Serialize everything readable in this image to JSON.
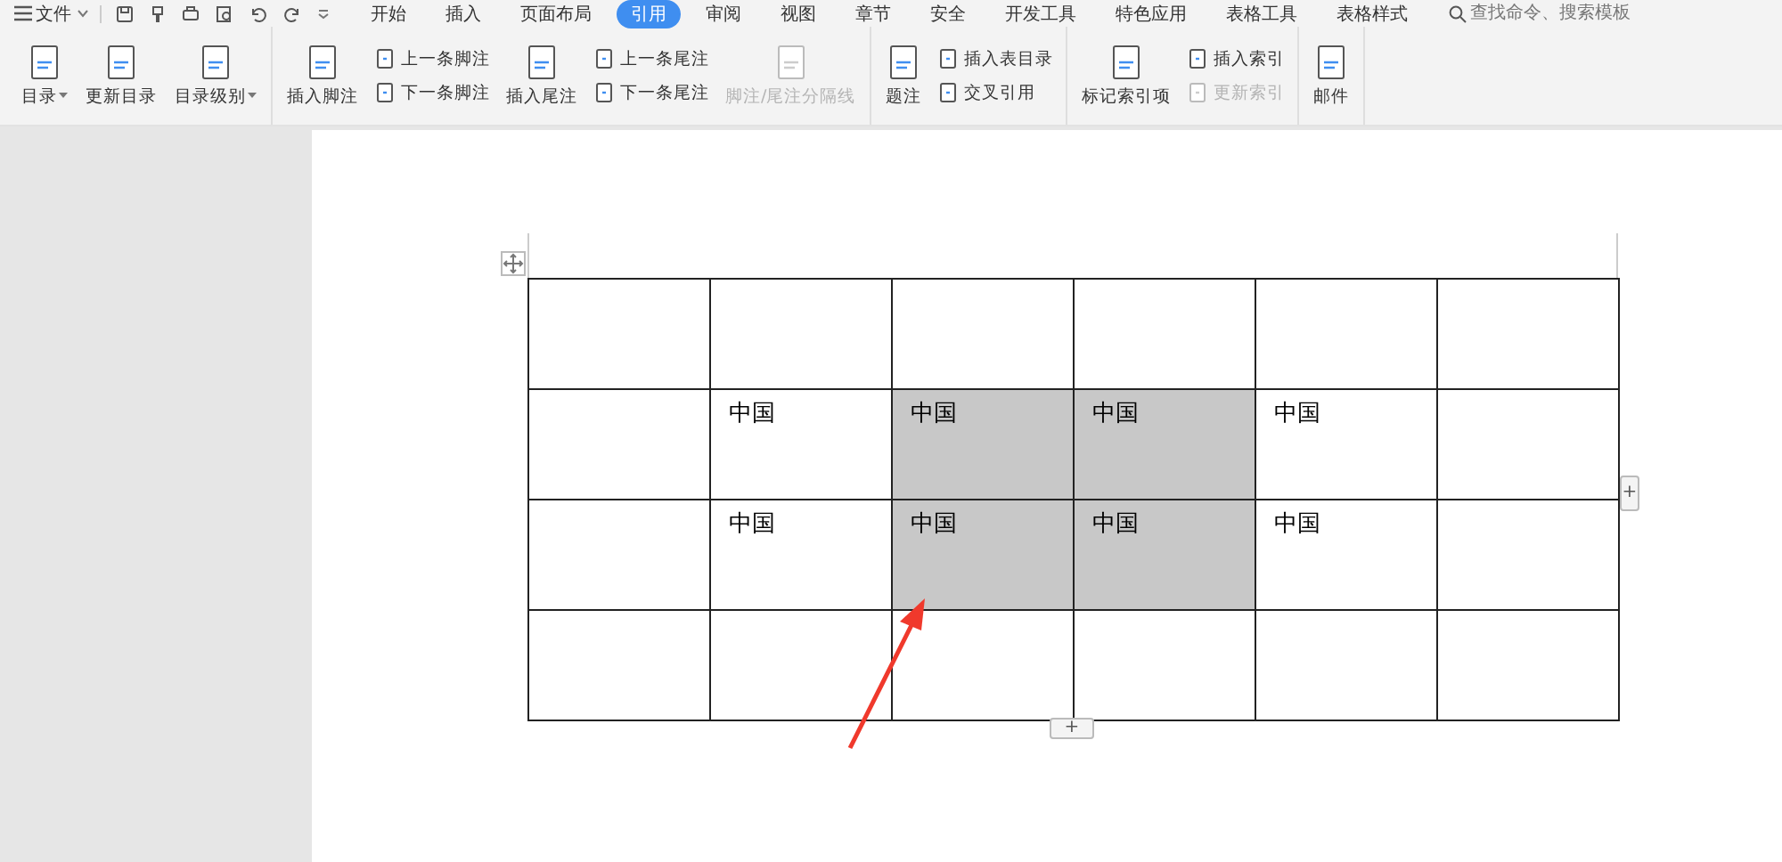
{
  "menubar": {
    "file_menu": "文件",
    "tabs": [
      {
        "label": "开始",
        "selected": false
      },
      {
        "label": "插入",
        "selected": false
      },
      {
        "label": "页面布局",
        "selected": false
      },
      {
        "label": "引用",
        "selected": true
      },
      {
        "label": "审阅",
        "selected": false
      },
      {
        "label": "视图",
        "selected": false
      },
      {
        "label": "章节",
        "selected": false
      },
      {
        "label": "安全",
        "selected": false
      },
      {
        "label": "开发工具",
        "selected": false
      },
      {
        "label": "特色应用",
        "selected": false
      },
      {
        "label": "表格工具",
        "selected": false
      },
      {
        "label": "表格样式",
        "selected": false
      }
    ],
    "search": {
      "placeholder": "查找命令、搜索模板"
    }
  },
  "ribbon": {
    "groups": [
      {
        "items": [
          {
            "kind": "large",
            "label": "目录",
            "dropdown": true,
            "disabled": false
          },
          {
            "kind": "large",
            "label": "更新目录",
            "dropdown": false,
            "disabled": false
          },
          {
            "kind": "large",
            "label": "目录级别",
            "dropdown": true,
            "disabled": false
          }
        ]
      },
      {
        "items": [
          {
            "kind": "large",
            "label": "插入脚注",
            "dropdown": false,
            "disabled": false
          },
          {
            "kind": "pair",
            "items": [
              {
                "label": "上一条脚注",
                "disabled": false
              },
              {
                "label": "下一条脚注",
                "disabled": false
              }
            ]
          },
          {
            "kind": "large",
            "label": "插入尾注",
            "dropdown": false,
            "disabled": false
          },
          {
            "kind": "pair",
            "items": [
              {
                "label": "上一条尾注",
                "disabled": false
              },
              {
                "label": "下一条尾注",
                "disabled": false
              }
            ]
          },
          {
            "kind": "large",
            "label": "脚注/尾注分隔线",
            "dropdown": false,
            "disabled": true
          }
        ]
      },
      {
        "items": [
          {
            "kind": "large",
            "label": "题注",
            "dropdown": false,
            "disabled": false
          },
          {
            "kind": "pair",
            "items": [
              {
                "label": "插入表目录",
                "disabled": false
              },
              {
                "label": "交叉引用",
                "disabled": false
              }
            ]
          }
        ]
      },
      {
        "items": [
          {
            "kind": "large",
            "label": "标记索引项",
            "dropdown": false,
            "disabled": false
          },
          {
            "kind": "pair",
            "items": [
              {
                "label": "插入索引",
                "disabled": false
              },
              {
                "label": "更新索引",
                "disabled": true
              }
            ]
          }
        ]
      },
      {
        "items": [
          {
            "kind": "large",
            "label": "邮件",
            "dropdown": false,
            "disabled": false
          }
        ]
      }
    ]
  },
  "table": {
    "rows": [
      [
        {
          "text": "",
          "selected": false
        },
        {
          "text": "",
          "selected": false
        },
        {
          "text": "",
          "selected": false
        },
        {
          "text": "",
          "selected": false
        },
        {
          "text": "",
          "selected": false
        },
        {
          "text": "",
          "selected": false
        }
      ],
      [
        {
          "text": "",
          "selected": false
        },
        {
          "text": "中国",
          "selected": false
        },
        {
          "text": "中国",
          "selected": true
        },
        {
          "text": "中国",
          "selected": true
        },
        {
          "text": "中国",
          "selected": false
        },
        {
          "text": "",
          "selected": false
        }
      ],
      [
        {
          "text": "",
          "selected": false
        },
        {
          "text": "中国",
          "selected": false
        },
        {
          "text": "中国",
          "selected": true
        },
        {
          "text": "中国",
          "selected": true
        },
        {
          "text": "中国",
          "selected": false
        },
        {
          "text": "",
          "selected": false
        }
      ],
      [
        {
          "text": "",
          "selected": false
        },
        {
          "text": "",
          "selected": false
        },
        {
          "text": "",
          "selected": false
        },
        {
          "text": "",
          "selected": false
        },
        {
          "text": "",
          "selected": false
        },
        {
          "text": "",
          "selected": false
        }
      ]
    ],
    "add_column_button": "+",
    "add_row_button": "+"
  }
}
